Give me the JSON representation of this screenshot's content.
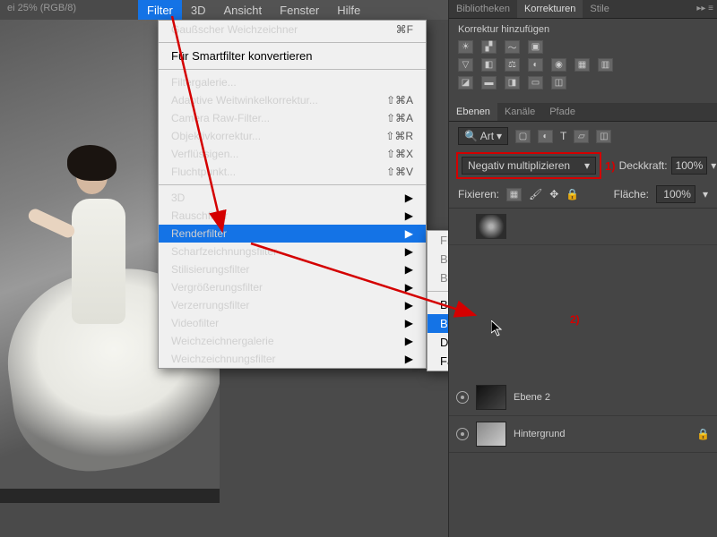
{
  "title": "ei 25% (RGB/8)",
  "menubar": [
    "Filter",
    "3D",
    "Ansicht",
    "Fenster",
    "Hilfe"
  ],
  "menubar_active": 0,
  "filter_menu": {
    "repeat": {
      "label": "Gaußscher Weichzeichner",
      "shortcut": "⌘F"
    },
    "smart": "Für Smartfilter konvertieren",
    "items": [
      {
        "label": "Filtergalerie..."
      },
      {
        "label": "Adaptive Weitwinkelkorrektur...",
        "shortcut": "⇧⌘A"
      },
      {
        "label": "Camera Raw-Filter...",
        "shortcut": "⇧⌘A"
      },
      {
        "label": "Objektivkorrektur...",
        "shortcut": "⇧⌘R"
      },
      {
        "label": "Verflüssigen...",
        "shortcut": "⇧⌘X"
      },
      {
        "label": "Fluchtpunkt...",
        "shortcut": "⇧⌘V"
      }
    ],
    "sub": [
      "3D",
      "Rauschfilter",
      "Renderfilter",
      "Scharfzeichnungsfilter",
      "Stilisierungsfilter",
      "Vergrößerungsfilter",
      "Verzerrungsfilter",
      "Videofilter",
      "Weichzeichnergalerie",
      "Weichzeichnungsfilter"
    ],
    "sub_hilite": 2
  },
  "render_submenu": {
    "dim": [
      "Flamme…",
      "Bilderrahmen…",
      "Baum…"
    ],
    "items": [
      "Beleuchtungseffekte…",
      "Blendenflecke…",
      "Differenz-Wolken",
      "Fasern…"
    ],
    "hilite": 1
  },
  "right": {
    "tabs1": [
      "Bibliotheken",
      "Korrekturen",
      "Stile"
    ],
    "tabs1_active": 1,
    "adj_label": "Korrektur hinzufügen",
    "tabs2": [
      "Ebenen",
      "Kanäle",
      "Pfade"
    ],
    "tabs2_active": 0,
    "search_kind": "Art",
    "blend_mode": "Negativ multiplizieren",
    "opacity_label": "Deckkraft:",
    "opacity_value": "100%",
    "lock_label": "Fixieren:",
    "fill_label": "Fläche:",
    "fill_value": "100%",
    "layers": [
      {
        "name": "Ebene 2",
        "thumb": "dark"
      },
      {
        "name": "Hintergrund",
        "thumb": "photo"
      }
    ]
  },
  "annotations": {
    "n1": "1)",
    "n2": "2)"
  }
}
